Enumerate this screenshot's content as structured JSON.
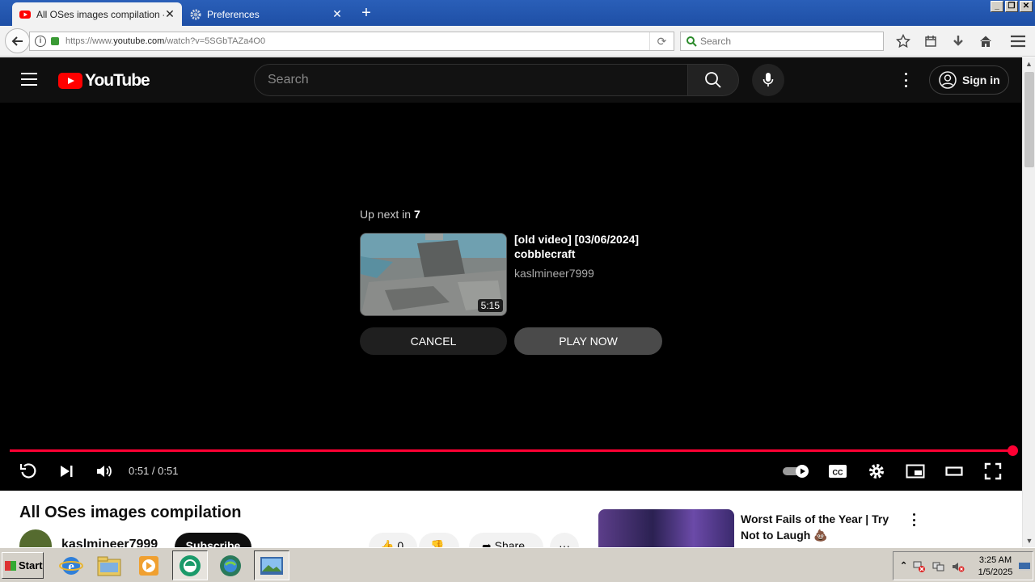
{
  "browser": {
    "tabs": [
      {
        "label": "All OSes images compilation - Y",
        "active": true
      },
      {
        "label": "Preferences",
        "active": false
      }
    ],
    "url_prefix": "https://www.",
    "url_domain": "youtube.com",
    "url_path": "/watch?v=5SGbTAZa4O0",
    "search_placeholder": "Search"
  },
  "youtube": {
    "logo_text": "YouTube",
    "search_placeholder": "Search",
    "signin_label": "Sign in"
  },
  "player": {
    "upnext_prefix": "Up next in ",
    "upnext_count": "7",
    "next_title": "[old video] [03/06/2024] cobblecraft",
    "next_channel": "kaslmineer7999",
    "next_duration": "5:15",
    "cancel_label": "CANCEL",
    "play_now_label": "PLAY NOW",
    "time": "0:51 / 0:51",
    "progress": 1.0
  },
  "video": {
    "title": "All OSes images compilation",
    "channel": "kaslmineer7999",
    "subscribe_label": "Subscribe",
    "like_count": "0",
    "share_label": "Share"
  },
  "sidebar": {
    "recommended_title": "Worst Fails of the Year | Try Not to Laugh 💩"
  },
  "taskbar": {
    "start_label": "Start",
    "time": "3:25 AM",
    "date": "1/5/2025"
  },
  "colors": {
    "yt_red": "#ff0000",
    "progress_red": "#ff0033",
    "tabbar_blue": "#1e4fa6"
  }
}
